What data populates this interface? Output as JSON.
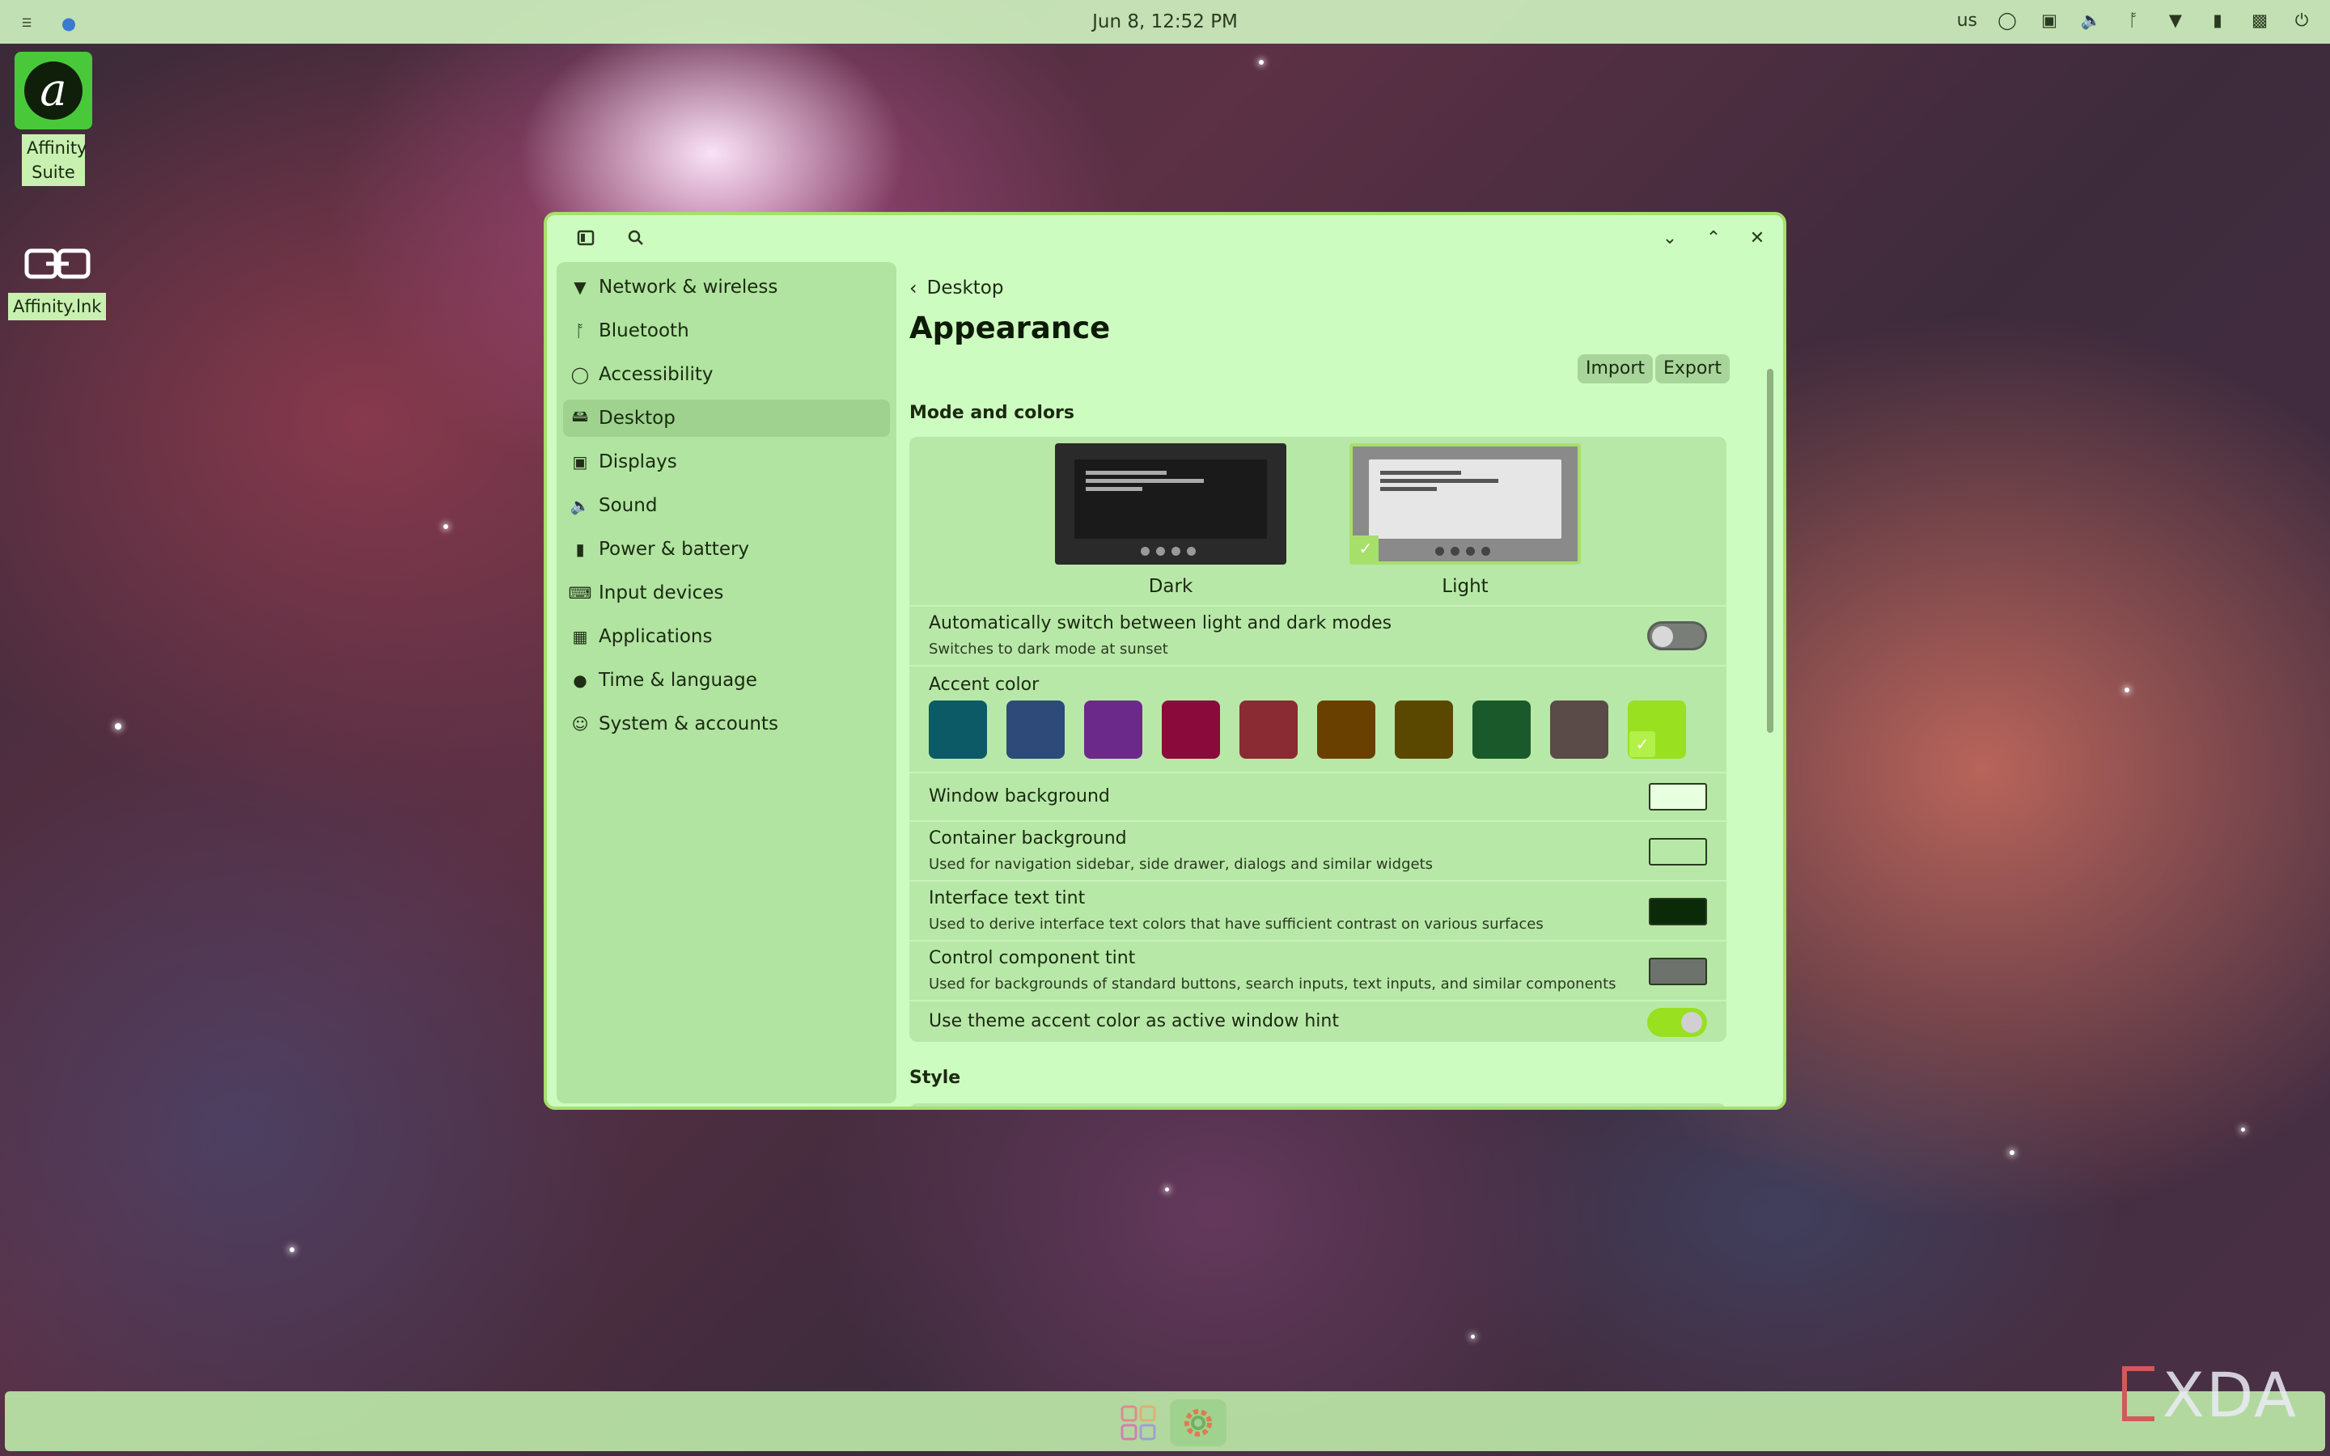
{
  "top_panel": {
    "clock": "Jun 8, 12:52 PM",
    "keyboard_layout": "us",
    "tray_icons": [
      "accessibility-icon",
      "display-icon",
      "volume-icon",
      "bluetooth-icon",
      "wifi-icon",
      "battery-icon",
      "notifications-icon",
      "power-icon"
    ]
  },
  "desktop": {
    "icons": [
      {
        "label": "Affinity\nSuite",
        "icon": "affinity-suite-icon"
      },
      {
        "label": "Affinity.lnk",
        "icon": "link-icon"
      }
    ]
  },
  "window": {
    "sidebar": {
      "items": [
        {
          "label": "Network & wireless",
          "icon": "wifi-icon"
        },
        {
          "label": "Bluetooth",
          "icon": "bluetooth-icon"
        },
        {
          "label": "Accessibility",
          "icon": "accessibility-icon"
        },
        {
          "label": "Desktop",
          "icon": "desktop-icon",
          "active": true
        },
        {
          "label": "Displays",
          "icon": "display-icon"
        },
        {
          "label": "Sound",
          "icon": "speaker-icon"
        },
        {
          "label": "Power & battery",
          "icon": "battery-icon"
        },
        {
          "label": "Input devices",
          "icon": "keyboard-icon"
        },
        {
          "label": "Applications",
          "icon": "apps-grid-icon"
        },
        {
          "label": "Time & language",
          "icon": "globe-icon"
        },
        {
          "label": "System & accounts",
          "icon": "users-icon"
        }
      ]
    },
    "content": {
      "breadcrumb": "Desktop",
      "title": "Appearance",
      "import_label": "Import",
      "export_label": "Export",
      "mode_section": "Mode and colors",
      "modes": {
        "dark": "Dark",
        "light": "Light",
        "selected": "Light"
      },
      "auto_switch": {
        "title": "Automatically switch between light and dark modes",
        "subtitle": "Switches to dark mode at sunset",
        "enabled": false
      },
      "accent": {
        "title": "Accent color",
        "colors": [
          "#0b5a66",
          "#2d4a78",
          "#6b2a8a",
          "#8a0a3c",
          "#8a2a32",
          "#6a4000",
          "#5a4800",
          "#1a5a2a",
          "#5a4a48",
          "#98e020"
        ],
        "selected": "#98e020"
      },
      "window_background": {
        "title": "Window background",
        "color": "#e8ffe0"
      },
      "container_background": {
        "title": "Container background",
        "subtitle": "Used for navigation sidebar, side drawer, dialogs and similar widgets",
        "color": "#b8e8a8"
      },
      "interface_text_tint": {
        "title": "Interface text tint",
        "subtitle": "Used to derive interface text colors that have sufficient contrast on various surfaces",
        "color": "#0a2a08"
      },
      "control_component_tint": {
        "title": "Control component tint",
        "subtitle": "Used for backgrounds of standard buttons, search inputs, text inputs, and similar components",
        "color": "#6e726c"
      },
      "accent_hint": {
        "title": "Use theme accent color as active window hint",
        "enabled": true
      },
      "style_section": "Style"
    }
  },
  "watermark": "XDA"
}
